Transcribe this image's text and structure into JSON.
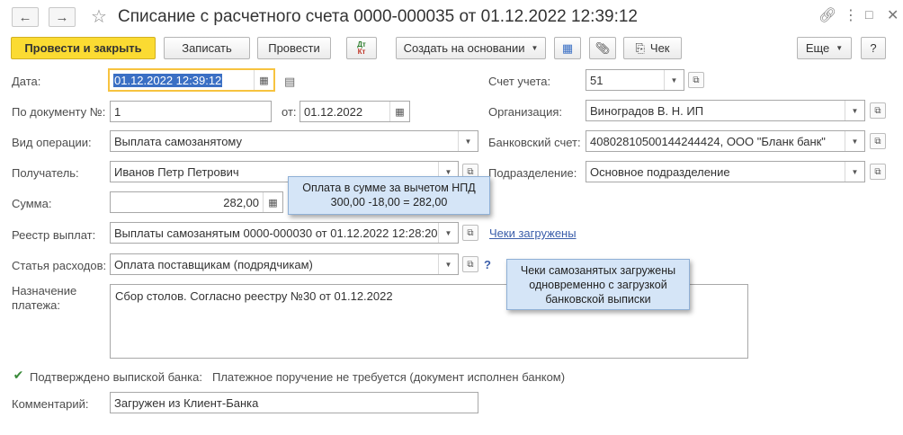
{
  "title": "Списание с расчетного счета 0000-000035 от 01.12.2022 12:39:12",
  "toolbar": {
    "post_close": "Провести и закрыть",
    "save": "Записать",
    "post": "Провести",
    "dtkt_top": "Дт",
    "dtkt_bottom": "Кт",
    "create_based": "Создать на основании",
    "check": "Чек",
    "more": "Еще",
    "help": "?"
  },
  "fields": {
    "date_label": "Дата:",
    "date_value": "01.12.2022 12:39:12",
    "doc_no_label": "По документу №:",
    "doc_no_value": "1",
    "from_label": "от:",
    "from_value": "01.12.2022",
    "operation_label": "Вид операции:",
    "operation_value": "Выплата самозанятому",
    "recipient_label": "Получатель:",
    "recipient_value": "Иванов Петр Петрович",
    "sum_label": "Сумма:",
    "sum_value": "282,00",
    "registry_label": "Реестр выплат:",
    "registry_value": "Выплаты самозанятым 0000-000030 от 01.12.2022 12:28:20",
    "receipts_link": "Чеки загружены",
    "expense_label": "Статья расходов:",
    "expense_value": "Оплата поставщикам (подрядчикам)",
    "expense_help": "?",
    "purpose_label_1": "Назначение",
    "purpose_label_2": "платежа:",
    "purpose_value": "Сбор столов. Согласно реестру №30 от 01.12.2022",
    "confirmed_label": "Подтверждено выпиской банка:",
    "confirmed_text": "Платежное поручение не требуется (документ исполнен банком)",
    "comment_label": "Комментарий:",
    "comment_value": "Загружен из Клиент-Банка",
    "account_label": "Счет учета:",
    "account_value": "51",
    "org_label": "Организация:",
    "org_value": "Виноградов В. Н. ИП",
    "bank_label": "Банковский счет:",
    "bank_value": "40802810500144244424, ООО \"Бланк банк\"",
    "division_label": "Подразделение:",
    "division_value": "Основное подразделение"
  },
  "callouts": {
    "sum_line1": "Оплата в сумме за вычетом НПД",
    "sum_line2": "300,00 -18,00 = 282,00",
    "receipts_line1": "Чеки самозанятых загружены",
    "receipts_line2": "одновременно с загрузкой",
    "receipts_line3": "банковской выписки"
  },
  "colors": {
    "primary_button": "#fbdb32",
    "focus": "#f7c33f",
    "link": "#3b5eaa",
    "callout_bg": "#d5e5f7"
  }
}
